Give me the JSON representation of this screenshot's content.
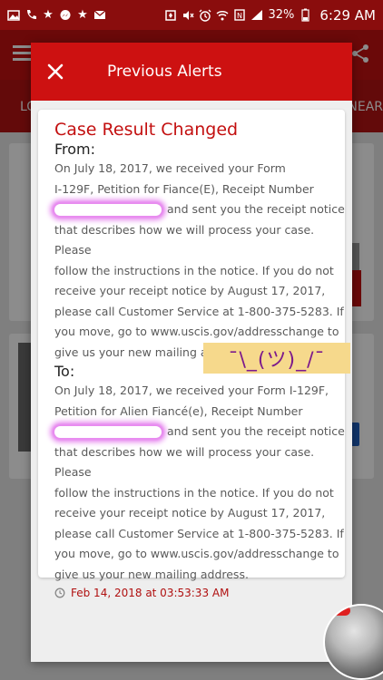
{
  "status_bar": {
    "battery": "32%",
    "time": "6:29 AM",
    "left_icons": [
      "image-icon",
      "phone-icon",
      "star-icon",
      "messenger-icon",
      "star-icon",
      "mail-icon"
    ],
    "right_icons": [
      "app-icon",
      "mute-icon",
      "alarm-icon",
      "wifi-icon",
      "nfc-icon",
      "signal-icon"
    ]
  },
  "tabs": {
    "left": "LO",
    "right": "NEAR"
  },
  "dialog": {
    "title": "Previous Alerts"
  },
  "alert": {
    "heading": "Case Result Changed",
    "from_label": "From:",
    "from_line1": "On July 18, 2017, we received your Form",
    "from_line2": "I-129F, Petition for Fiance(E), Receipt Number",
    "from_after_redaction": "and sent you the receipt notice",
    "from_line4": "that describes how we will process your case. Please",
    "from_line5": "follow the instructions in the notice. If you do not",
    "from_line6": "receive your receipt notice by August 17, 2017,",
    "from_line7": "please call Customer Service at 1-800-375-5283. If",
    "from_line8": "you move, go to www.uscis.gov/addresschange to",
    "from_line9": "give us your new mailing address.",
    "to_label": "To:",
    "to_line1": "On July 18, 2017, we received your Form I-129F,",
    "to_line2": "Petition for Alien Fiancé(e), Receipt Number",
    "to_after_redaction": "and sent you the receipt notice",
    "to_line4": "that describes how we will process your case. Please",
    "to_line5": "follow the instructions in the notice. If you do not",
    "to_line6": "receive your receipt notice by August 17, 2017,",
    "to_line7": "please call Customer Service at 1-800-375-5283. If",
    "to_line8": "you move, go to www.uscis.gov/addresschange to",
    "to_line9": "give us your new mailing address.",
    "timestamp": "Feb 14, 2018 at 03:53:33 AM"
  },
  "sticker": {
    "text": "¯\\_(ツ)_/¯"
  },
  "colors": {
    "status_bar": "#8a0d0d",
    "app_bar": "#c41212",
    "dialog_header": "#cd1111",
    "heading_red": "#c31010",
    "timestamp_red": "#b01010",
    "sticker_bg": "#f6d98c",
    "highlight": "#e88ff0"
  }
}
